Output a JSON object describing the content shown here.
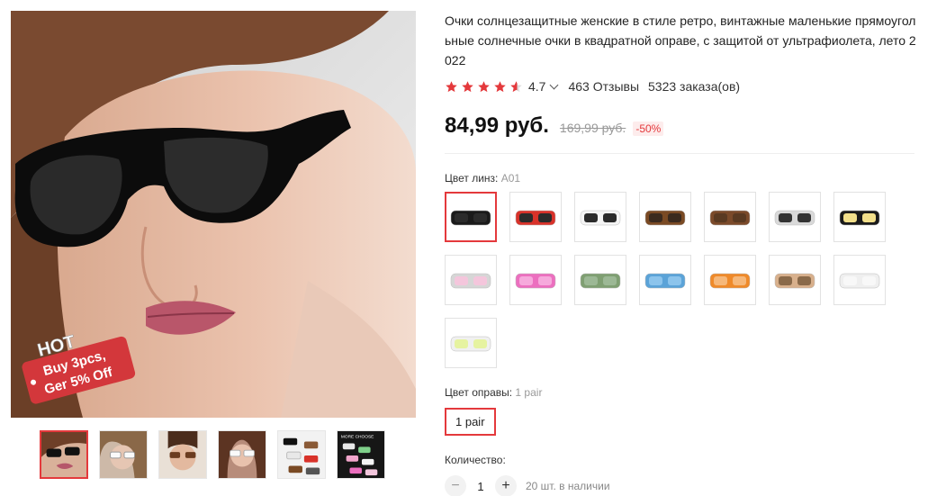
{
  "product": {
    "title": "Очки солнцезащитные женские в стиле ретро, винтажные маленькие прямоугольные солнечные очки в квадратной оправе, с защитой от ультрафиолета, лето 2022",
    "rating": "4.7",
    "reviews": "463 Отзывы",
    "orders": "5323 заказа(ов)",
    "price": "84,99 руб.",
    "old_price": "169,99 руб.",
    "discount": "-50%"
  },
  "promo": {
    "hot": "HOT",
    "line1": "Buy 3pcs,",
    "line2": "Ger 5% Off"
  },
  "gallery": {
    "thumb6_text": "MORE CHOOSE",
    "thumbs": [
      "dark-sunglasses",
      "white-frame",
      "brown-frame",
      "white-frame",
      "assorted",
      "assorted"
    ]
  },
  "lens": {
    "label": "Цвет линз:",
    "selected": "A01",
    "swatches": [
      {
        "frame": "#1a1a1a",
        "lens": "#2b2b2b"
      },
      {
        "frame": "#d8322a",
        "lens": "#2b2b2b"
      },
      {
        "frame": "#f4f4f4",
        "lens": "#2b2b2b"
      },
      {
        "frame": "#7a4a24",
        "lens": "#3b2a1e"
      },
      {
        "frame": "#7b4a2a",
        "lens": "#5a3a22"
      },
      {
        "frame": "#d9d9d9",
        "lens": "#333333"
      },
      {
        "frame": "#1a1a1a",
        "lens": "#f2df8a"
      },
      {
        "frame": "#d6d6d6",
        "lens": "#f4c6dc"
      },
      {
        "frame": "#ec6fbf",
        "lens": "#f6a9dc"
      },
      {
        "frame": "#7f9f72",
        "lens": "#9cb895"
      },
      {
        "frame": "#5ba3d8",
        "lens": "#8cc4ec"
      },
      {
        "frame": "#ef8a2a",
        "lens": "#f6b87a"
      },
      {
        "frame": "#d8b08c",
        "lens": "#8a6a4a"
      },
      {
        "frame": "#efefef",
        "lens": "#f8f8f8"
      },
      {
        "frame": "#f0f0f0",
        "lens": "#e6f3a0"
      }
    ]
  },
  "frame": {
    "label": "Цвет оправы:",
    "selected": "1 pair",
    "button": "1 pair"
  },
  "quantity": {
    "label": "Количество:",
    "minus": "−",
    "value": "1",
    "plus": "+",
    "stock": "20 шт. в наличии"
  }
}
